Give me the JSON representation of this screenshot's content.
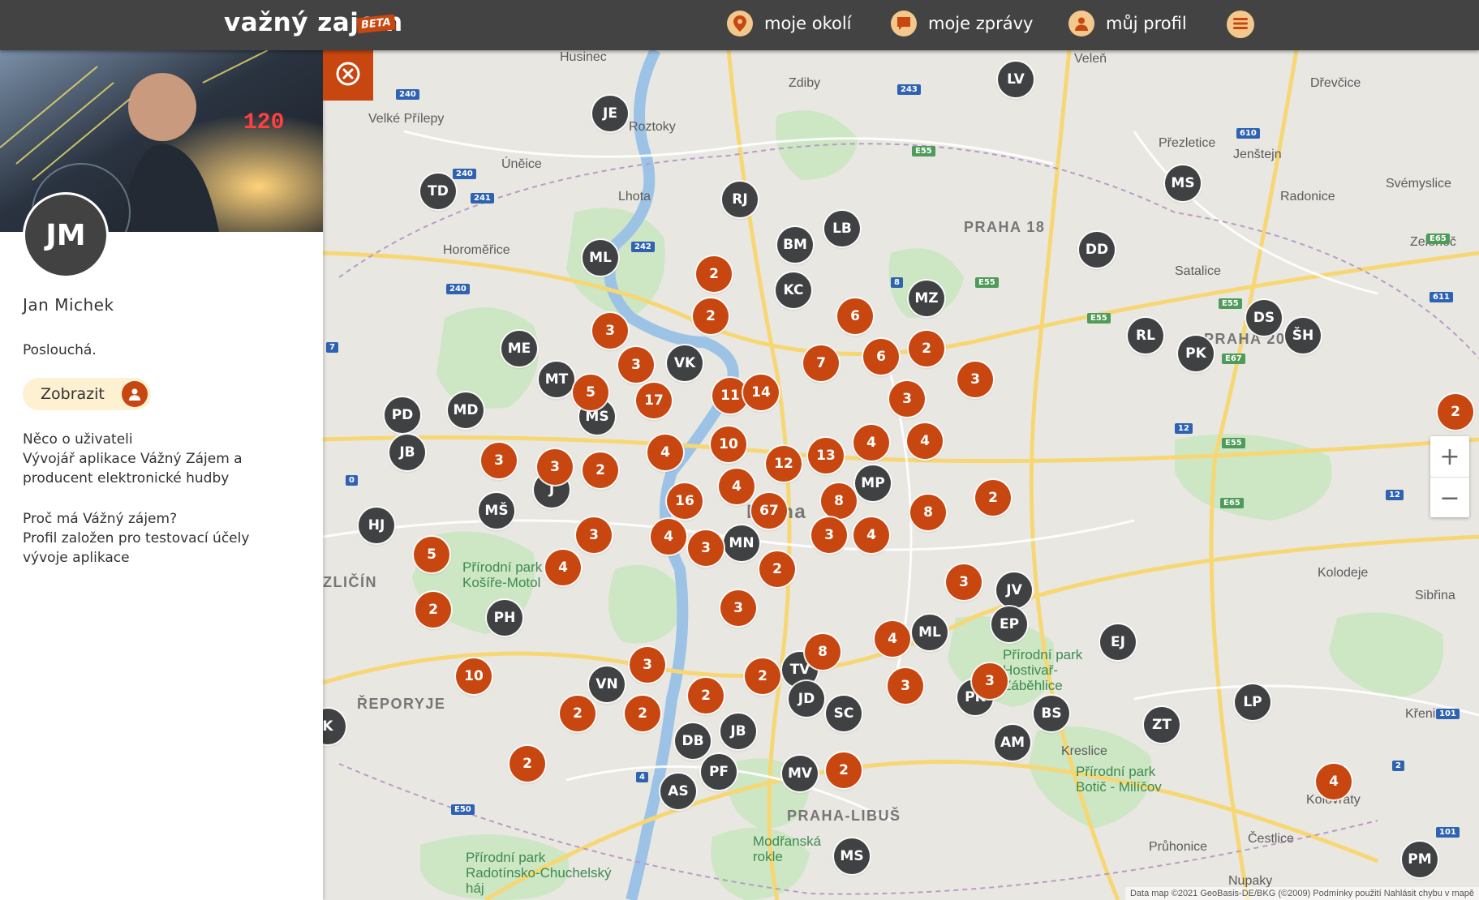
{
  "header": {
    "logo": "važný zajem",
    "beta": "BETA",
    "nav": [
      {
        "label": "moje okolí",
        "icon": "map-pin-icon"
      },
      {
        "label": "moje zprávy",
        "icon": "chat-icon"
      },
      {
        "label": "můj profil",
        "icon": "user-icon"
      }
    ],
    "menu_icon": "hamburger-icon"
  },
  "profile": {
    "initials": "JM",
    "name": "Jan Michek",
    "status": "Poslouchá.",
    "show_button": "Zobrazit",
    "about_title": "Něco o uživateli",
    "about_text": "Vývojář aplikace Vážný Zájem a producent elektronické hudby",
    "why_title": "Proč má Vážný zájem?",
    "why_text": "Profil založen pro testovací účely vývoje aplikace"
  },
  "map": {
    "places": [
      "Husinec",
      "Zdiby",
      "Veleň",
      "Dřevčice",
      "Velké Přílepy",
      "Roztoky",
      "Úněice",
      "Lhota",
      "Přezletice",
      "Jenštejn",
      "Svémyslice",
      "Radonice",
      "Zeleneč",
      "Horoměřice",
      "Satalice",
      "PRAHA 18",
      "PRAHA 20",
      "Přírodní park Košíře-Motol",
      "Přírodní park Hostivař-Záběhlice",
      "ŘEPORYJE",
      "ZLIČÍN",
      "Kolodeje",
      "Sibřina",
      "Křenice",
      "Kreslice",
      "Přírodní park Botič - Milíčov",
      "Průhonice",
      "Čestlice",
      "Nupaky",
      "PRAHA-LIBUŠ",
      "Modřanská rokle",
      "Přírodní park Radotínsko-Chuchelský háj",
      "Kolovraty",
      "Praha"
    ],
    "markers": [
      {
        "label": "JE",
        "kind": "user"
      },
      {
        "label": "LV",
        "kind": "user"
      },
      {
        "label": "TD",
        "kind": "user"
      },
      {
        "label": "RJ",
        "kind": "user"
      },
      {
        "label": "LB",
        "kind": "user"
      },
      {
        "label": "BM",
        "kind": "user"
      },
      {
        "label": "MS",
        "kind": "user"
      },
      {
        "label": "ML",
        "kind": "user"
      },
      {
        "label": "DD",
        "kind": "user"
      },
      {
        "label": "KC",
        "kind": "user"
      },
      {
        "label": "MZ",
        "kind": "user"
      },
      {
        "label": "DS",
        "kind": "user"
      },
      {
        "label": "RL",
        "kind": "user"
      },
      {
        "label": "ŠH",
        "kind": "user"
      },
      {
        "label": "PK",
        "kind": "user"
      },
      {
        "label": "ME",
        "kind": "user"
      },
      {
        "label": "MT",
        "kind": "user"
      },
      {
        "label": "VK",
        "kind": "user"
      },
      {
        "label": "PD",
        "kind": "user"
      },
      {
        "label": "MD",
        "kind": "user"
      },
      {
        "label": "MS",
        "kind": "user"
      },
      {
        "label": "JB",
        "kind": "user"
      },
      {
        "label": "MP",
        "kind": "user"
      },
      {
        "label": "J",
        "kind": "user"
      },
      {
        "label": "MŠ",
        "kind": "user"
      },
      {
        "label": "HJ",
        "kind": "user"
      },
      {
        "label": "MN",
        "kind": "user"
      },
      {
        "label": "JV",
        "kind": "user"
      },
      {
        "label": "EP",
        "kind": "user"
      },
      {
        "label": "PH",
        "kind": "user"
      },
      {
        "label": "ML",
        "kind": "user"
      },
      {
        "label": "EJ",
        "kind": "user"
      },
      {
        "label": "VN",
        "kind": "user"
      },
      {
        "label": "TV",
        "kind": "user"
      },
      {
        "label": "JD",
        "kind": "user"
      },
      {
        "label": "PK",
        "kind": "user"
      },
      {
        "label": "LP",
        "kind": "user"
      },
      {
        "label": "SC",
        "kind": "user"
      },
      {
        "label": "BS",
        "kind": "user"
      },
      {
        "label": "K",
        "kind": "user"
      },
      {
        "label": "JB",
        "kind": "user"
      },
      {
        "label": "DB",
        "kind": "user"
      },
      {
        "label": "ZT",
        "kind": "user"
      },
      {
        "label": "AM",
        "kind": "user"
      },
      {
        "label": "PF",
        "kind": "user"
      },
      {
        "label": "MV",
        "kind": "user"
      },
      {
        "label": "AS",
        "kind": "user"
      },
      {
        "label": "MS",
        "kind": "user"
      },
      {
        "label": "PM",
        "kind": "user"
      },
      {
        "label": "2",
        "kind": "cluster"
      },
      {
        "label": "2",
        "kind": "cluster"
      },
      {
        "label": "6",
        "kind": "cluster"
      },
      {
        "label": "3",
        "kind": "cluster"
      },
      {
        "label": "6",
        "kind": "cluster"
      },
      {
        "label": "2",
        "kind": "cluster"
      },
      {
        "label": "3",
        "kind": "cluster"
      },
      {
        "label": "7",
        "kind": "cluster"
      },
      {
        "label": "3",
        "kind": "cluster"
      },
      {
        "label": "5",
        "kind": "cluster"
      },
      {
        "label": "17",
        "kind": "cluster"
      },
      {
        "label": "11",
        "kind": "cluster"
      },
      {
        "label": "14",
        "kind": "cluster"
      },
      {
        "label": "3",
        "kind": "cluster"
      },
      {
        "label": "2",
        "kind": "cluster"
      },
      {
        "label": "4",
        "kind": "cluster"
      },
      {
        "label": "4",
        "kind": "cluster"
      },
      {
        "label": "3",
        "kind": "cluster"
      },
      {
        "label": "3",
        "kind": "cluster"
      },
      {
        "label": "2",
        "kind": "cluster"
      },
      {
        "label": "4",
        "kind": "cluster"
      },
      {
        "label": "10",
        "kind": "cluster"
      },
      {
        "label": "12",
        "kind": "cluster"
      },
      {
        "label": "13",
        "kind": "cluster"
      },
      {
        "label": "4",
        "kind": "cluster"
      },
      {
        "label": "16",
        "kind": "cluster"
      },
      {
        "label": "67",
        "kind": "cluster"
      },
      {
        "label": "8",
        "kind": "cluster"
      },
      {
        "label": "8",
        "kind": "cluster"
      },
      {
        "label": "2",
        "kind": "cluster"
      },
      {
        "label": "3",
        "kind": "cluster"
      },
      {
        "label": "4",
        "kind": "cluster"
      },
      {
        "label": "3",
        "kind": "cluster"
      },
      {
        "label": "3",
        "kind": "cluster"
      },
      {
        "label": "4",
        "kind": "cluster"
      },
      {
        "label": "4",
        "kind": "cluster"
      },
      {
        "label": "2",
        "kind": "cluster"
      },
      {
        "label": "5",
        "kind": "cluster"
      },
      {
        "label": "3",
        "kind": "cluster"
      },
      {
        "label": "3",
        "kind": "cluster"
      },
      {
        "label": "4",
        "kind": "cluster"
      },
      {
        "label": "8",
        "kind": "cluster"
      },
      {
        "label": "2",
        "kind": "cluster"
      },
      {
        "label": "3",
        "kind": "cluster"
      },
      {
        "label": "2",
        "kind": "cluster"
      },
      {
        "label": "10",
        "kind": "cluster"
      },
      {
        "label": "3",
        "kind": "cluster"
      },
      {
        "label": "3",
        "kind": "cluster"
      },
      {
        "label": "2",
        "kind": "cluster"
      },
      {
        "label": "2",
        "kind": "cluster"
      },
      {
        "label": "2",
        "kind": "cluster"
      },
      {
        "label": "2",
        "kind": "cluster"
      },
      {
        "label": "2",
        "kind": "cluster"
      },
      {
        "label": "4",
        "kind": "cluster"
      },
      {
        "label": "2",
        "kind": "cluster"
      }
    ],
    "zoom_in": "+",
    "zoom_out": "−",
    "attribution": "Data map ©2021 GeoBasis-DE/BKG (©2009)  Podmínky použití  Nahlásit chybu v mapě"
  },
  "colors": {
    "accent": "#c8460f",
    "topbar": "#444343",
    "user_marker": "#3f4142",
    "pill": "#fdf1d1"
  }
}
